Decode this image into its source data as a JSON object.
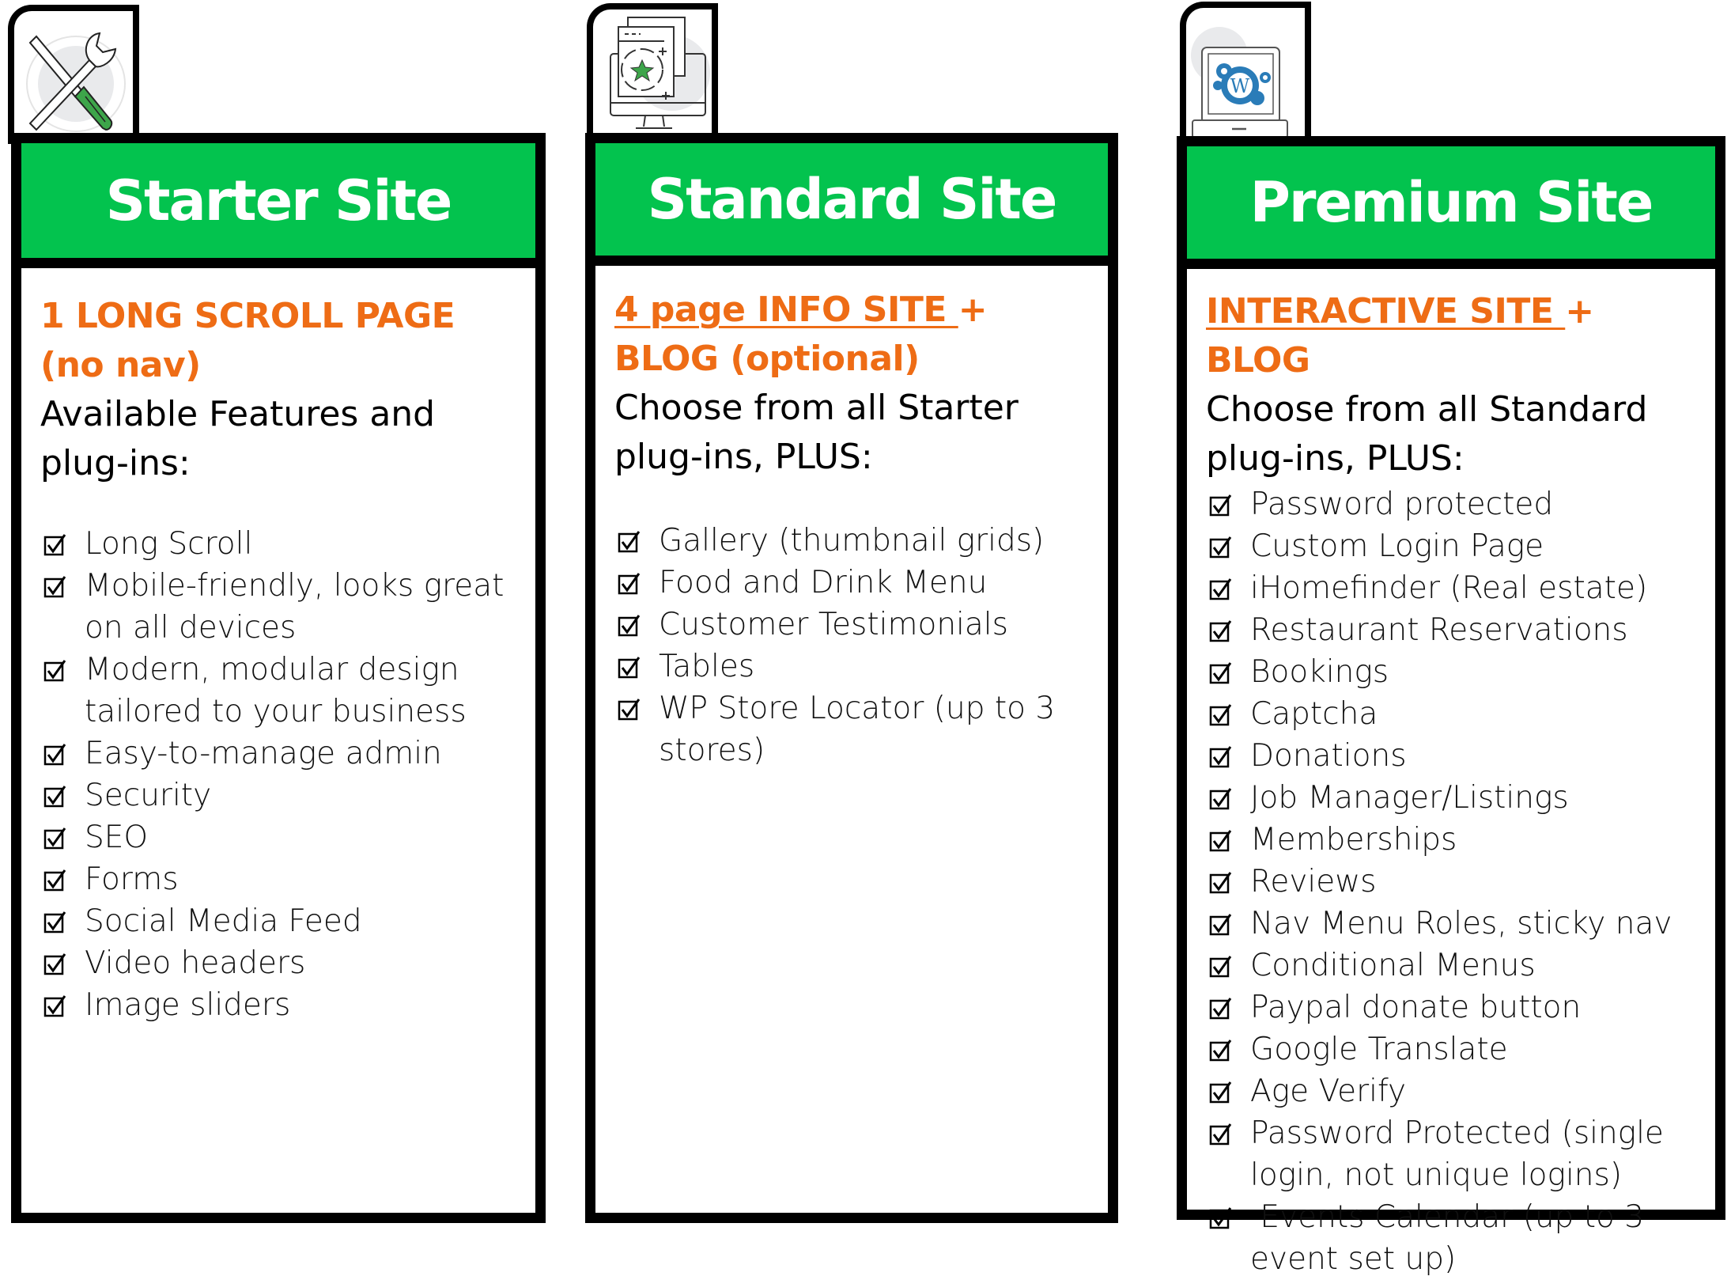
{
  "colors": {
    "header_green": "#03C34E",
    "accent_orange": "#EE6C15",
    "border": "#000000",
    "wordpress_blue": "#2A7CB8",
    "icon_green": "#3DA54A"
  },
  "cards": [
    {
      "icon": "tools-icon",
      "title": "Starter Site",
      "tagline": {
        "underlined": "",
        "rest": "1 LONG SCROLL PAGE (no nav)"
      },
      "intro": "Available Features and plug-ins:",
      "features": [
        "Long Scroll",
        "Mobile-friendly, looks great on all devices",
        "Modern, modular design tailored to your business",
        "Easy-to-manage admin",
        "Security",
        "SEO",
        "Forms",
        "Social Media Feed",
        "Video headers",
        "Image sliders"
      ]
    },
    {
      "icon": "monitor-star-icon",
      "title": "Standard Site",
      "tagline": {
        "underlined": "4 page INFO SITE ",
        "rest": "+ BLOG (optional)"
      },
      "intro": "Choose from all Starter plug-ins, PLUS:",
      "features": [
        "Gallery (thumbnail grids)",
        "Food and Drink Menu",
        "Customer Testimonials",
        "Tables",
        "WP Store Locator (up to 3 stores)"
      ]
    },
    {
      "icon": "laptop-wordpress-icon",
      "title": "Premium Site",
      "tagline": {
        "underlined": "INTERACTIVE SITE ",
        "rest": "+ BLOG"
      },
      "intro": "Choose from all Standard plug-ins, PLUS:",
      "features": [
        "Password protected",
        "Custom Login Page",
        "iHomefinder (Real estate)",
        "Restaurant Reservations",
        "Bookings",
        "Captcha",
        "Donations",
        "Job Manager/Listings",
        "Memberships",
        "Reviews",
        "Nav Menu Roles, sticky nav",
        "Conditional Menus",
        "Paypal donate button",
        "Google Translate",
        "Age Verify",
        "Password Protected (single login, not unique logins)",
        " Events Calendar (up to 3 event set up)"
      ]
    }
  ]
}
